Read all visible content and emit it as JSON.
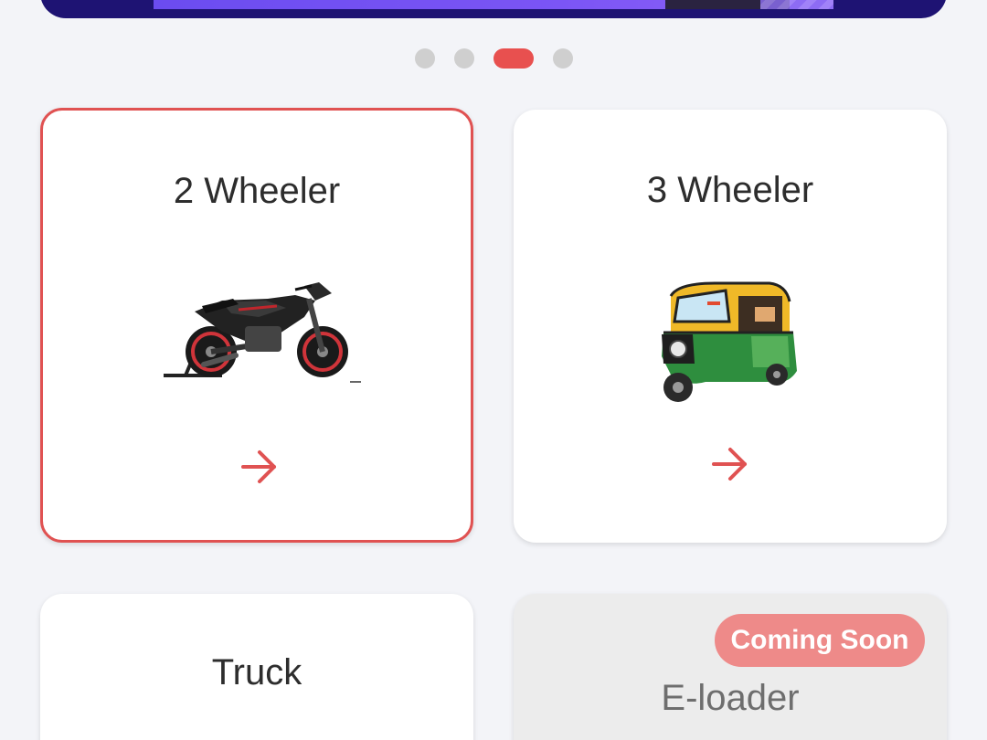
{
  "carousel": {
    "dots": 4,
    "active_index": 2
  },
  "vehicles": [
    {
      "title": "2 Wheeler",
      "icon": "motorcycle-icon",
      "selected": true
    },
    {
      "title": "3 Wheeler",
      "icon": "auto-rickshaw-icon",
      "selected": false
    },
    {
      "title": "Truck",
      "icon": "truck-icon",
      "selected": false
    },
    {
      "title": "E-loader",
      "icon": "e-loader-icon",
      "selected": false,
      "badge": "Coming Soon"
    }
  ],
  "colors": {
    "accent": "#e05252",
    "background": "#f3f4f8",
    "badge": "#ee8a89",
    "banner": "#1e1373"
  }
}
